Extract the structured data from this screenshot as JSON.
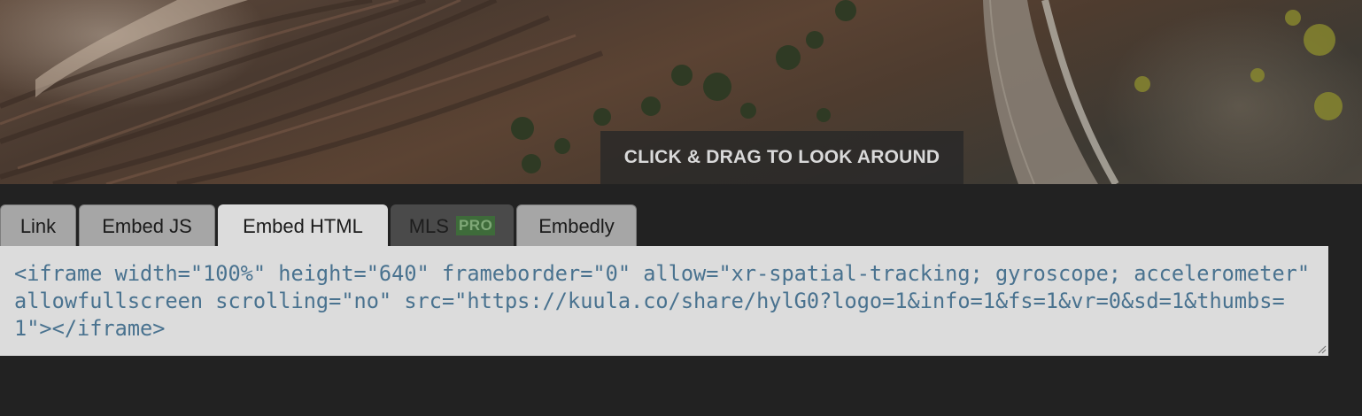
{
  "viewer": {
    "hint": "CLICK & DRAG TO LOOK AROUND"
  },
  "tabs": [
    {
      "label": "Link",
      "state": "normal"
    },
    {
      "label": "Embed JS",
      "state": "normal"
    },
    {
      "label": "Embed HTML",
      "state": "active"
    },
    {
      "label": "MLS",
      "badge": "PRO",
      "state": "disabled"
    },
    {
      "label": "Embedly",
      "state": "normal"
    }
  ],
  "embed_code": "<iframe width=\"100%\" height=\"640\" frameborder=\"0\" allow=\"xr-spatial-tracking; gyroscope; accelerometer\" allowfullscreen scrolling=\"no\" src=\"https://kuula.co/share/hylG0?logo=1&info=1&fs=1&vr=0&sd=1&thumbs=1\"></iframe>",
  "colors": {
    "background": "#222222",
    "tab_inactive": "#a6a6a6",
    "tab_active": "#dcdcdc",
    "tab_disabled": "#4a4a4a",
    "pro_badge": "#3e6b3a",
    "code_text": "#49728f"
  }
}
